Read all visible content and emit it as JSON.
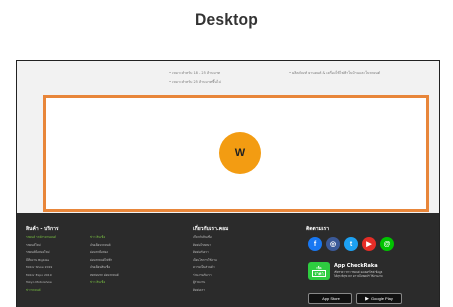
{
  "heading": "Desktop",
  "top_bullets": [
    "• เหมาะสำหรับ 18 - 25 ล้านบาท",
    "• เหมาะสำหรับ 25 ล้านบาทขึ้นไป",
    "• ผลิตภัณฑ์ ยานยนต์ & เครื่องใช้ไฟฟ้าในบ้านและในรถยนต์"
  ],
  "ad_logo": "W",
  "footer": {
    "col1": {
      "title": "สินค้า - บริการ",
      "links": [
        "รถยนต์ รถจักรยานยนต์",
        "รถยนต์ใหม่",
        "รถยนต์มือสองใหม่",
        "มีทีมงาน Bigbike",
        "Motor Show 2019",
        "Motor Expo 2019",
        "Tokyo Motorshow",
        "ข่าวรถยนต์"
      ]
    },
    "col2": {
      "links": [
        "ข่าว สินเชื่อ",
        "เงินเดือนรถยนต์",
        "ผ่อนรถมือสอง",
        "ผ่อนรถยนต์ไฟฟ้า",
        "เงินเดือนสินเชื่อ",
        "ทดสอบรถ ผ่อนรถยนต์",
        "ข่าว สินเชื่อ"
      ]
    },
    "col3": {
      "title": "เกี่ยวกับเรา.คอม",
      "links": [
        "เกี่ยวกับสินเชื่อ",
        "ติดต่อโฆษณา",
        "ติดต่อกับเรา",
        "เงื่อนไขการใช้งาน",
        "ความเป็นส่วนตัว",
        "ร่วมงานกับเรา",
        "ผู้ร่วมงาน",
        "ติดต่อเรา"
      ]
    },
    "col4": {
      "title": "ติดตามเรา",
      "socials": [
        {
          "icon": "facebook-icon",
          "glyph": "f"
        },
        {
          "icon": "instagram-icon",
          "glyph": "◎"
        },
        {
          "icon": "twitter-icon",
          "glyph": "t"
        },
        {
          "icon": "youtube-icon",
          "glyph": "▶"
        },
        {
          "icon": "line-icon",
          "glyph": "@"
        }
      ],
      "app_badge_top": "เช็ค",
      "app_badge_bottom": "ราคา",
      "app_title": "App CheckRaka",
      "app_desc_1": "เช็คราคา ข่าว รถยนต์ มอเตอร์ไซค์ ข้อมูล",
      "app_desc_2": "ได้ทุก ที่ทุกเวลา ดาวน์โหลดฟรี ใช้งานง่าย",
      "app_store": "App Store",
      "google_play": "Google Play"
    }
  }
}
